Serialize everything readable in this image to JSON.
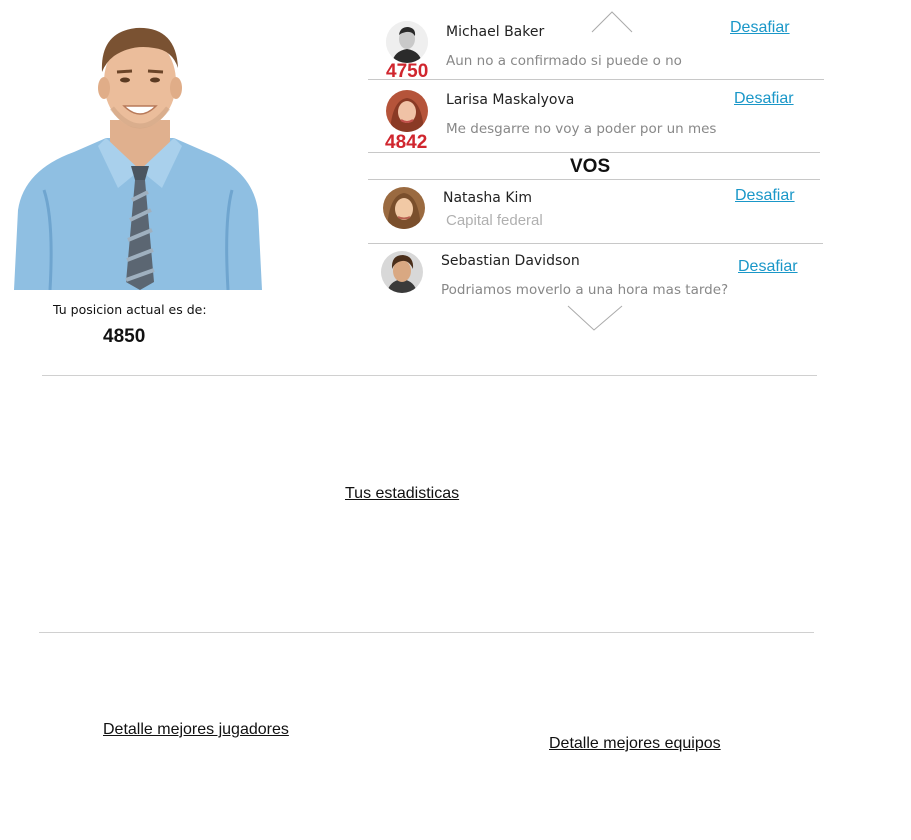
{
  "profile": {
    "position_label": "Tu posicion actual es de:",
    "position_value": "4850"
  },
  "ranking": {
    "challenge_label": "Desafiar",
    "current_user_label": "VOS",
    "above": [
      {
        "name": "Michael Baker",
        "message": "Aun no a confirmado si puede o no",
        "score": "4750"
      },
      {
        "name": "Larisa Maskalyova",
        "message": "Me desgarre no voy a poder por un mes",
        "score": "4842"
      }
    ],
    "below": [
      {
        "name": "Natasha Kim",
        "message": "Capital federal"
      },
      {
        "name": "Sebastian Davidson",
        "message": "Podriamos moverlo a una hora mas tarde?"
      }
    ]
  },
  "links": {
    "stats": "Tus estadisticas",
    "best_players": "Detalle mejores jugadores",
    "best_teams": "Detalle mejores equipos"
  },
  "colors": {
    "score": "#d0262e",
    "challenge_link": "#1a97c8",
    "divider": "#c8c8c8"
  },
  "icons": [
    "chevron-up-icon",
    "chevron-down-icon"
  ]
}
